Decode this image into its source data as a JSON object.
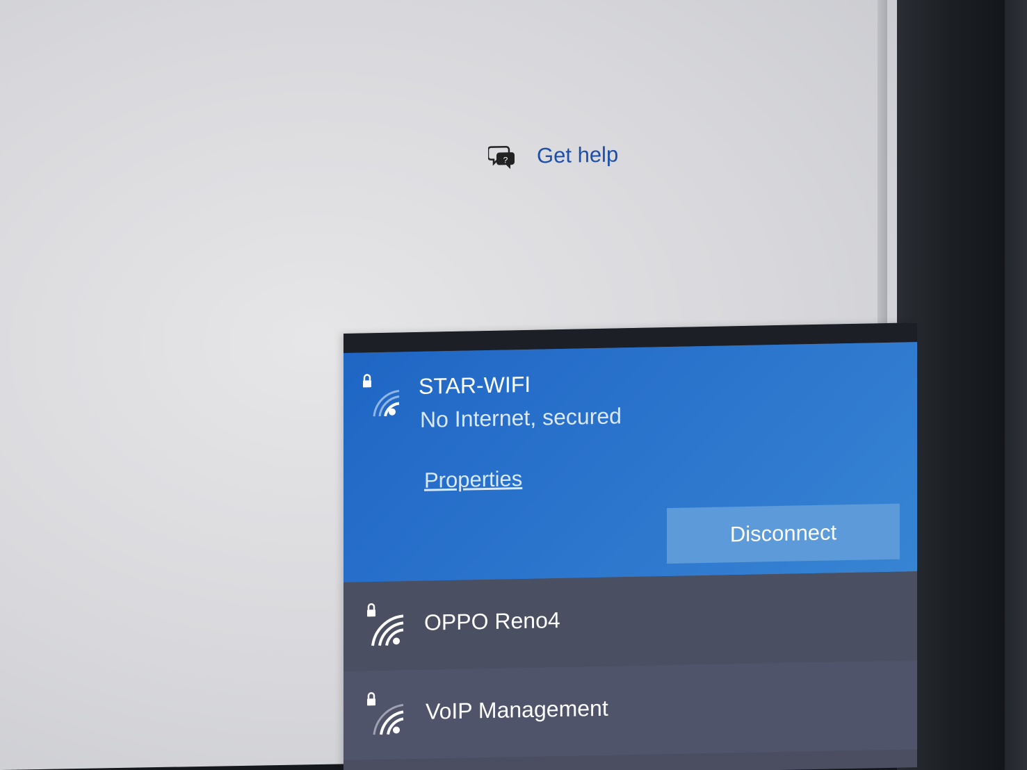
{
  "window": {
    "get_help_label": "Get help"
  },
  "flyout": {
    "connected_network": {
      "ssid": "STAR-WIFI",
      "status": "No Internet, secured",
      "properties_label": "Properties",
      "disconnect_label": "Disconnect"
    },
    "networks": [
      {
        "ssid": "OPPO Reno4"
      },
      {
        "ssid": "VoIP Management"
      }
    ]
  },
  "colors": {
    "accent_blue": "#2a73cc",
    "link_blue": "#1d4fa8",
    "flyout_bg": "#4b4f62",
    "button_blue": "#5c9ad9"
  },
  "icons": {
    "help": "chat-help-icon",
    "wifi": "wifi-signal-icon",
    "lock": "lock-icon"
  }
}
